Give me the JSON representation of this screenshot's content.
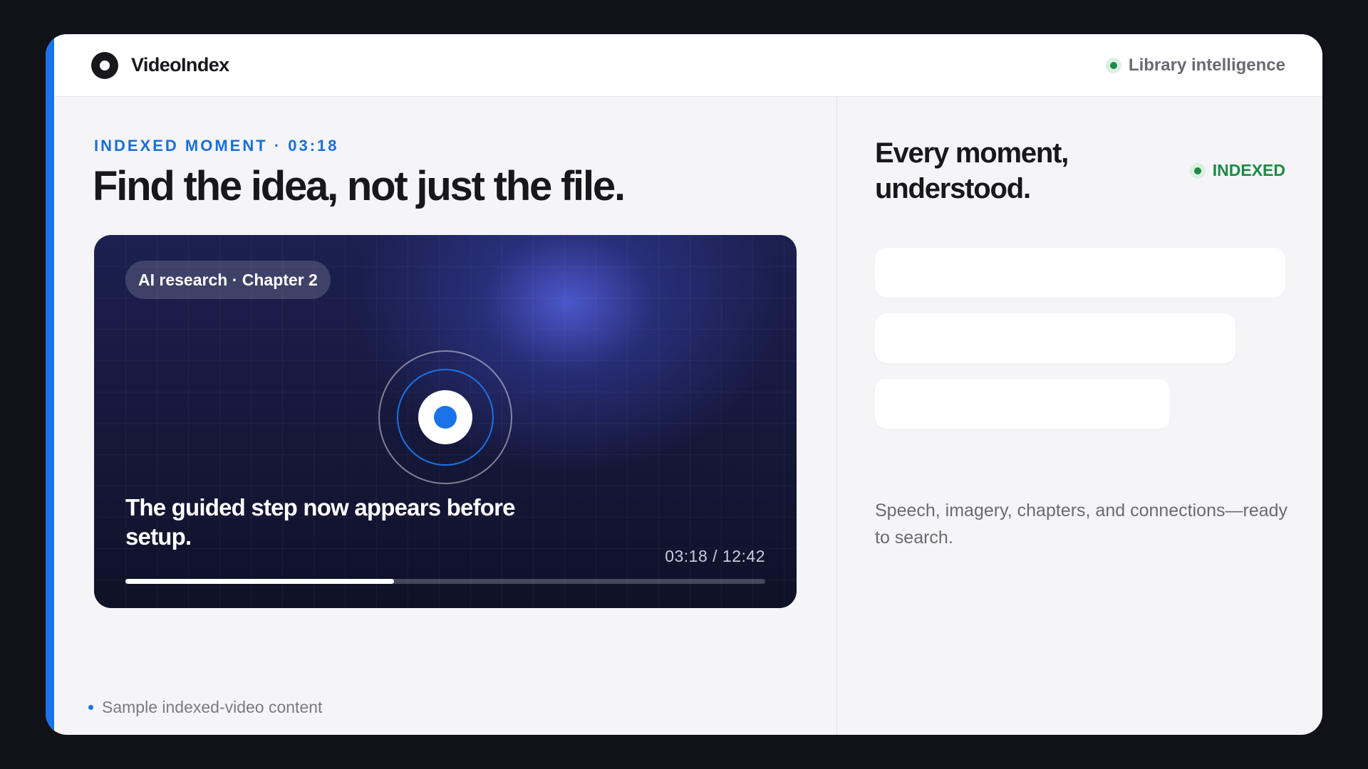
{
  "header": {
    "brand": "VideoIndex",
    "status_label": "Library intelligence"
  },
  "main": {
    "eyebrow": "INDEXED MOMENT · 03:18",
    "headline": "Find the idea, not just the file."
  },
  "video": {
    "chip_label": "AI research · Chapter 2",
    "caption": "The guided step now appears before setup.",
    "current_time": "03:18",
    "duration": "12:42",
    "time_display": "03:18 / 12:42",
    "progress_fraction": 0.42
  },
  "footer": {
    "note": "Sample indexed-video content"
  },
  "panel": {
    "title": "Every moment, understood.",
    "badge": "INDEXED",
    "description": "Speech, imagery, chapters, and connections—ready to search."
  },
  "colors": {
    "accent": "#1a73e8",
    "success": "#1e8a45",
    "ink": "#18181c",
    "background": "#111118"
  },
  "icons": {
    "brand": "record-circle-icon",
    "status": "status-dot-icon",
    "video_center": "target-rings-icon"
  }
}
